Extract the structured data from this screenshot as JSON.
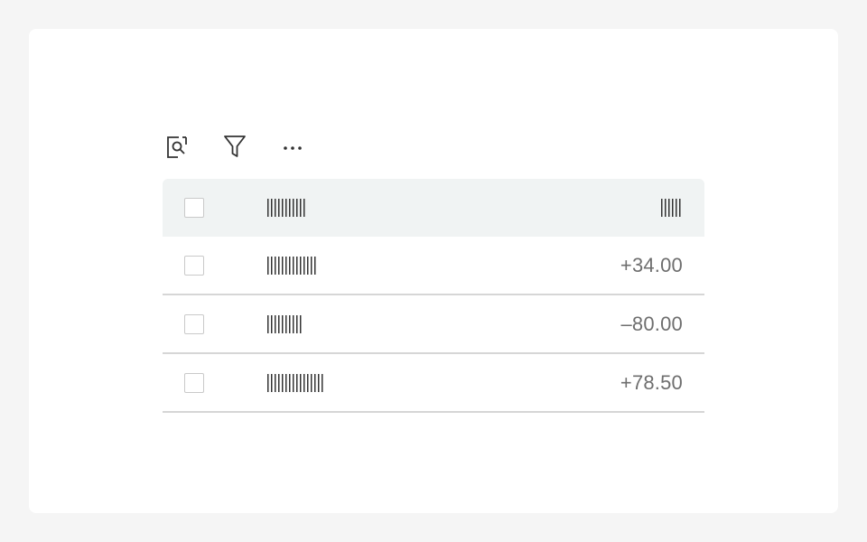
{
  "toolbar": {
    "icons": [
      "search-icon",
      "filter-icon",
      "more-icon"
    ]
  },
  "table": {
    "header": {
      "name_label_redacted": true,
      "amount_label_redacted": true
    },
    "rows": [
      {
        "amount": "+34.00",
        "checked": false
      },
      {
        "amount": "–80.00",
        "checked": false
      },
      {
        "amount": "+78.50",
        "checked": false
      }
    ]
  },
  "colors": {
    "page_background": "#f5f5f5",
    "card_background": "#ffffff",
    "header_background": "#f0f3f3",
    "divider": "#d6d6d6",
    "amount_text": "#6e6e6e",
    "icon_stroke": "#333333"
  }
}
